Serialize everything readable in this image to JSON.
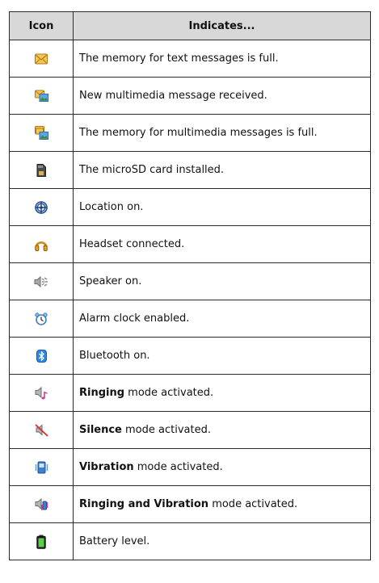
{
  "table": {
    "header_icon": "Icon",
    "header_indicates": "Indicates...",
    "rows": [
      {
        "icon": "message-full-icon",
        "pre": "",
        "bold": "",
        "post": "The memory for text messages is full."
      },
      {
        "icon": "new-mms-icon",
        "pre": "",
        "bold": "",
        "post": "New multimedia message received."
      },
      {
        "icon": "mms-full-icon",
        "pre": "",
        "bold": "",
        "post": "The memory for multimedia messages is full."
      },
      {
        "icon": "microsd-icon",
        "pre": "",
        "bold": "",
        "post": "The microSD card installed."
      },
      {
        "icon": "location-icon",
        "pre": "",
        "bold": "",
        "post": "Location on."
      },
      {
        "icon": "headset-icon",
        "pre": "",
        "bold": "",
        "post": "Headset connected."
      },
      {
        "icon": "speaker-icon",
        "pre": "",
        "bold": "",
        "post": "Speaker on."
      },
      {
        "icon": "alarm-clock-icon",
        "pre": "",
        "bold": "",
        "post": "Alarm clock enabled."
      },
      {
        "icon": "bluetooth-icon",
        "pre": "",
        "bold": "",
        "post": "Bluetooth on."
      },
      {
        "icon": "ringing-icon",
        "pre": "",
        "bold": "Ringing",
        "post": " mode activated."
      },
      {
        "icon": "silence-icon",
        "pre": "",
        "bold": "Silence",
        "post": " mode activated."
      },
      {
        "icon": "vibration-icon",
        "pre": "",
        "bold": "Vibration",
        "post": " mode activated."
      },
      {
        "icon": "ringing-vibration-icon",
        "pre": "",
        "bold": "Ringing and Vibration",
        "post": " mode activated."
      },
      {
        "icon": "battery-icon",
        "pre": "",
        "bold": "",
        "post": "Battery level."
      }
    ]
  }
}
